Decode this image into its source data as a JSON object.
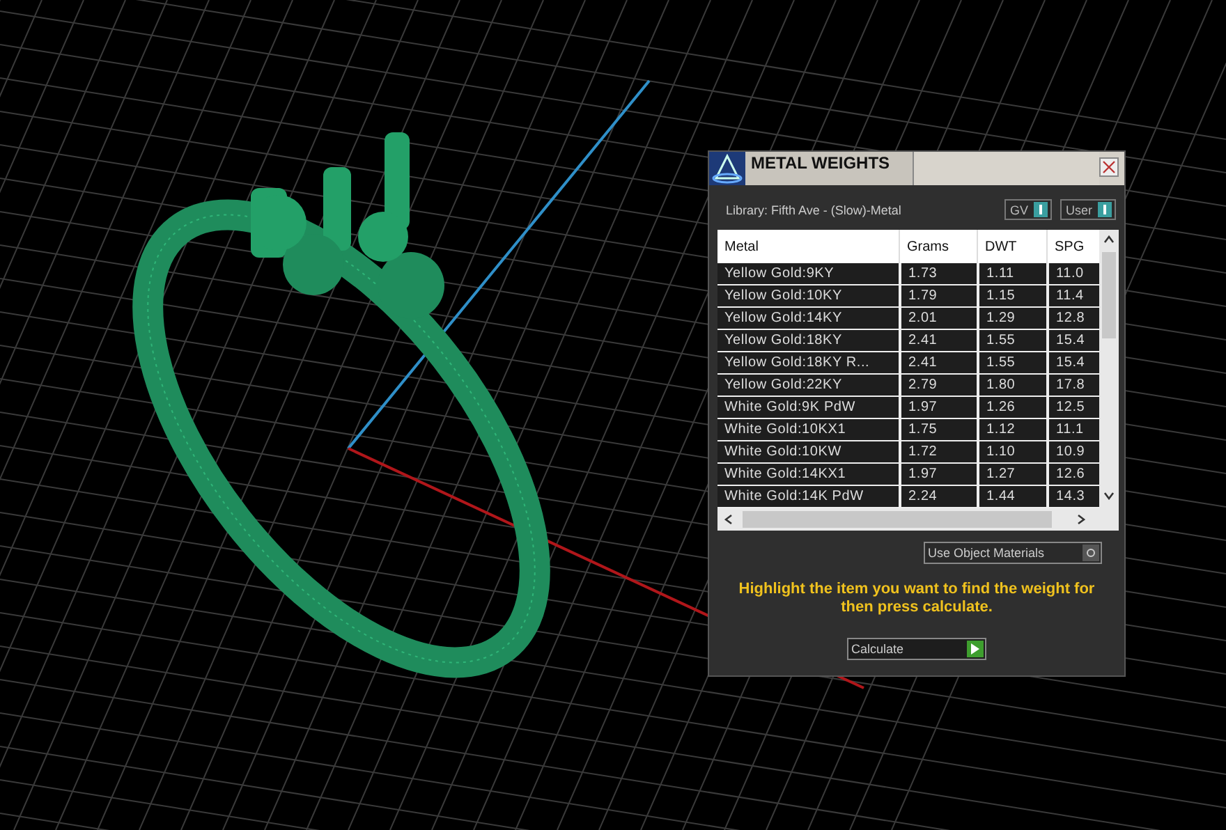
{
  "panel": {
    "title": "METAL WEIGHTS",
    "library": "Library: Fifth Ave - (Slow)-Metal",
    "toggles": [
      {
        "label": "GV",
        "on": true
      },
      {
        "label": "User",
        "on": true
      }
    ],
    "table": {
      "columns": [
        "Metal",
        "Grams",
        "DWT",
        "SPG"
      ],
      "rows": [
        {
          "cells": [
            "Yellow Gold:9KY",
            "1.73",
            "1.11",
            "11.0"
          ]
        },
        {
          "cells": [
            "Yellow Gold:10KY",
            "1.79",
            "1.15",
            "11.4"
          ]
        },
        {
          "cells": [
            "Yellow Gold:14KY",
            "2.01",
            "1.29",
            "12.8"
          ]
        },
        {
          "cells": [
            "Yellow Gold:18KY",
            "2.41",
            "1.55",
            "15.4"
          ]
        },
        {
          "cells": [
            "Yellow Gold:18KY R...",
            "2.41",
            "1.55",
            "15.4"
          ]
        },
        {
          "cells": [
            "Yellow Gold:22KY",
            "2.79",
            "1.80",
            "17.8"
          ]
        },
        {
          "cells": [
            "White Gold:9K PdW",
            "1.97",
            "1.26",
            "12.5"
          ]
        },
        {
          "cells": [
            "White Gold:10KX1",
            "1.75",
            "1.12",
            "11.1"
          ]
        },
        {
          "cells": [
            "White Gold:10KW",
            "1.72",
            "1.10",
            "10.9"
          ]
        },
        {
          "cells": [
            "White Gold:14KX1",
            "1.97",
            "1.27",
            "12.6"
          ]
        },
        {
          "cells": [
            "White Gold:14K PdW",
            "2.24",
            "1.44",
            "14.3"
          ]
        }
      ]
    },
    "use_object_materials": {
      "label": "Use Object Materials",
      "on": false
    },
    "hint": "Highlight the item you want to find the weight for then press calculate.",
    "calculate": {
      "label": "Calculate"
    }
  }
}
